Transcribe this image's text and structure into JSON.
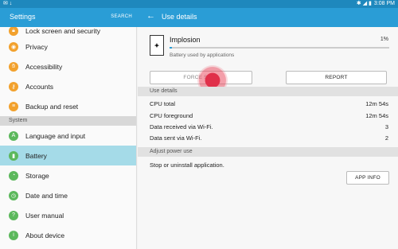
{
  "status": {
    "left_icons": "✉ ↓",
    "right_icons": "✱ ◢ ▮",
    "time": "3:08 PM"
  },
  "left_header": {
    "title": "Settings",
    "search": "SEARCH"
  },
  "right_header": {
    "title": "Use details"
  },
  "left_list": {
    "items_top": [
      {
        "label": "Lock screen and security",
        "icon": "lock-icon",
        "color": "#f2a12d"
      },
      {
        "label": "Privacy",
        "icon": "privacy-icon",
        "color": "#f2a12d"
      },
      {
        "label": "Accessibility",
        "icon": "accessibility-icon",
        "color": "#f2a12d"
      },
      {
        "label": "Accounts",
        "icon": "key-icon",
        "color": "#f2a12d"
      },
      {
        "label": "Backup and reset",
        "icon": "backup-icon",
        "color": "#f2a12d"
      }
    ],
    "section_label": "System",
    "items_system": [
      {
        "label": "Language and input",
        "icon": "language-icon",
        "color": "#5cb85c"
      },
      {
        "label": "Battery",
        "icon": "battery-icon",
        "color": "#5cb85c"
      },
      {
        "label": "Storage",
        "icon": "storage-icon",
        "color": "#5cb85c"
      },
      {
        "label": "Date and time",
        "icon": "clock-icon",
        "color": "#5cb85c"
      },
      {
        "label": "User manual",
        "icon": "manual-icon",
        "color": "#5cb85c"
      },
      {
        "label": "About device",
        "icon": "info-icon",
        "color": "#5cb85c"
      }
    ]
  },
  "detail": {
    "app_name": "Implosion",
    "percent": "1%",
    "progress_fraction": 0.01,
    "subtitle": "Battery used by applications",
    "force_stop_label": "FORCE STOP",
    "report_label": "REPORT",
    "use_details_header": "Use details",
    "rows": [
      {
        "label": "CPU total",
        "value": "12m 54s"
      },
      {
        "label": "CPU foreground",
        "value": "12m 54s"
      },
      {
        "label": "Data received via Wi-Fi.",
        "value": "3"
      },
      {
        "label": "Data sent via Wi-Fi.",
        "value": "2"
      }
    ],
    "adjust_header": "Adjust power use",
    "stop_text": "Stop or uninstall application.",
    "app_info_label": "APP INFO"
  }
}
